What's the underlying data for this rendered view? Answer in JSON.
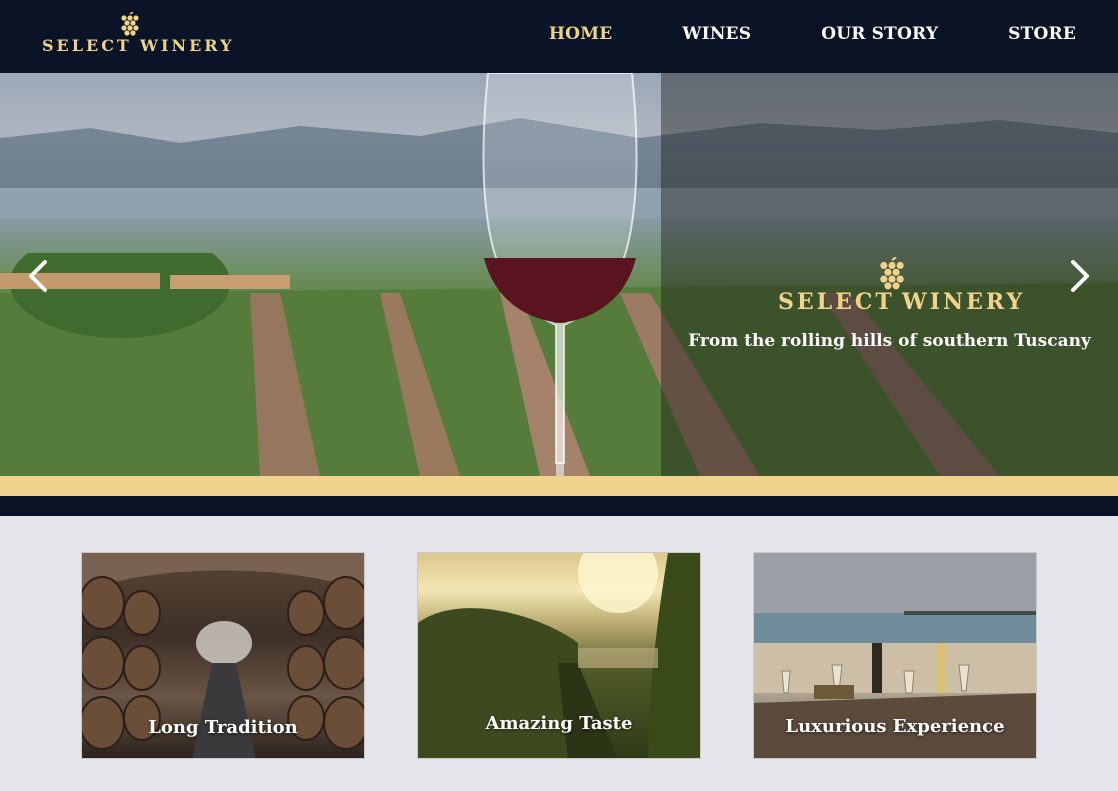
{
  "brand": {
    "word1": "SELECT",
    "word2": "WINERY"
  },
  "nav": {
    "items": [
      "HOME",
      "WINES",
      "OUR STORY",
      "STORE"
    ],
    "active": "HOME"
  },
  "hero": {
    "tagline": "From the rolling hills of southern Tuscany"
  },
  "cards": [
    {
      "label": "Long Tradition"
    },
    {
      "label": "Amazing Taste"
    },
    {
      "label": "Luxurious Experience"
    }
  ],
  "colors": {
    "navy": "#0a1426",
    "gold": "#f0d28a",
    "page_bg": "#e4e4ea"
  }
}
